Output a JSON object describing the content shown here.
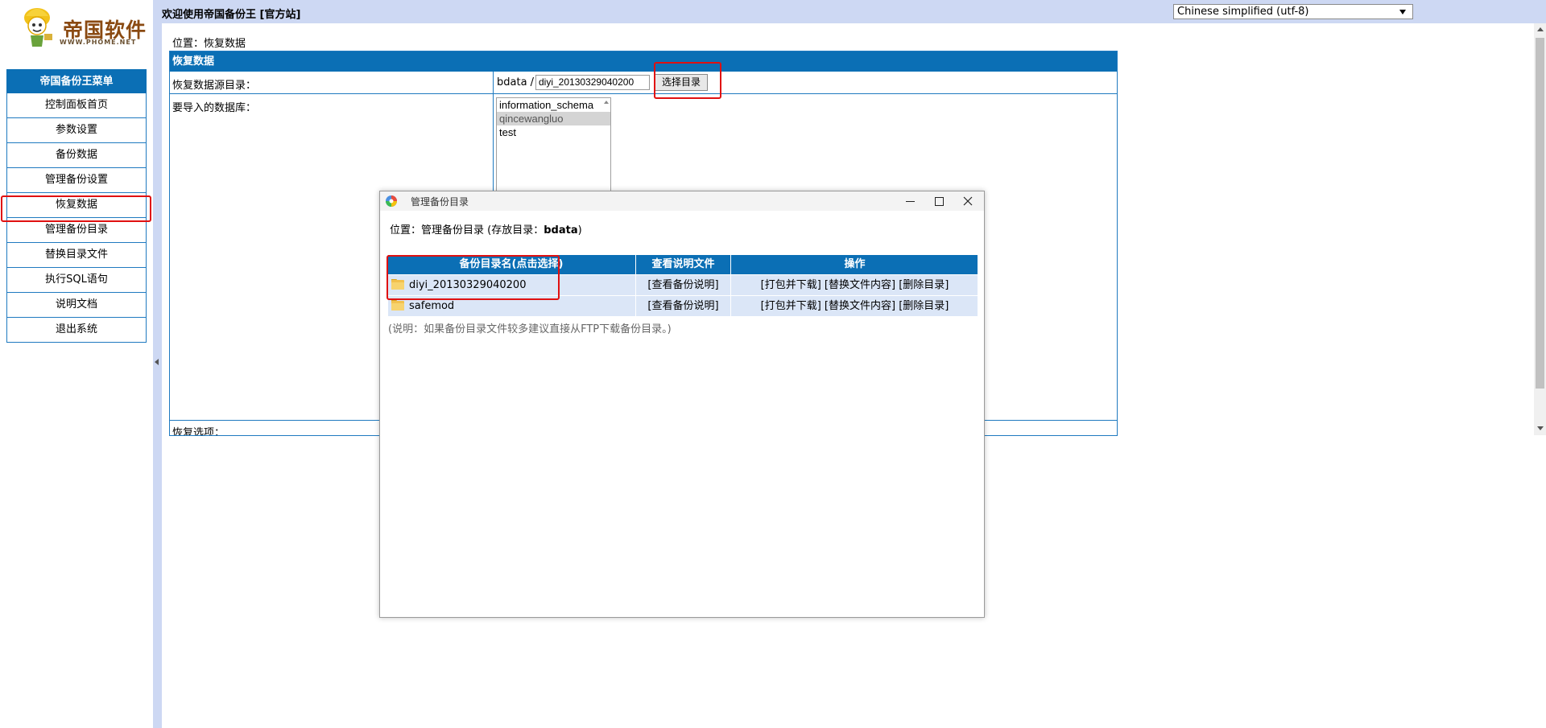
{
  "logo": {
    "text_cn": "帝国软件",
    "text_en": "WWW.PHOME.NET"
  },
  "menu": {
    "title": "帝国备份王菜单",
    "items": [
      {
        "label": "控制面板首页"
      },
      {
        "label": "参数设置"
      },
      {
        "label": "备份数据"
      },
      {
        "label": "管理备份设置"
      },
      {
        "label": "恢复数据"
      },
      {
        "label": "管理备份目录"
      },
      {
        "label": "替换目录文件"
      },
      {
        "label": "执行SQL语句"
      },
      {
        "label": "说明文档"
      },
      {
        "label": "退出系统"
      }
    ]
  },
  "topbar": {
    "welcome": "欢迎使用帝国备份王 [官方站]",
    "charset_selected": "Chinese simplified (utf-8)"
  },
  "main": {
    "breadcrumb": "位置：恢复数据",
    "table_title": "恢复数据",
    "source_label": "恢复数据源目录：",
    "source_prefix": "bdata /",
    "source_value": "diyi_20130329040200",
    "select_button": "选择目录",
    "db_label": "要导入的数据库：",
    "databases": [
      "information_schema",
      "qincewangluo",
      "test"
    ],
    "options_label": "恢复选项："
  },
  "dialog": {
    "title": "管理备份目录",
    "location_prefix": "位置：管理备份目录 (存放目录：",
    "location_dir": "bdata",
    "location_suffix": ")",
    "headers": [
      "备份目录名(点击选择)",
      "查看说明文件",
      "操作"
    ],
    "rows": [
      {
        "name": "diyi_20130329040200",
        "view": "[查看备份说明]",
        "op_download": "[打包并下载]",
        "op_replace": "[替换文件内容]",
        "op_delete": "[删除目录]"
      },
      {
        "name": "safemod",
        "view": "[查看备份说明]",
        "op_download": "[打包并下载]",
        "op_replace": "[替换文件内容]",
        "op_delete": "[删除目录]"
      }
    ],
    "note": "(说明：如果备份目录文件较多建议直接从FTP下载备份目录。)"
  },
  "colors": {
    "accent_blue": "#0b6fb5",
    "frame_bg": "#cdd8f3",
    "row_bg": "#dbe6f7",
    "highlight_red": "#e01010"
  }
}
